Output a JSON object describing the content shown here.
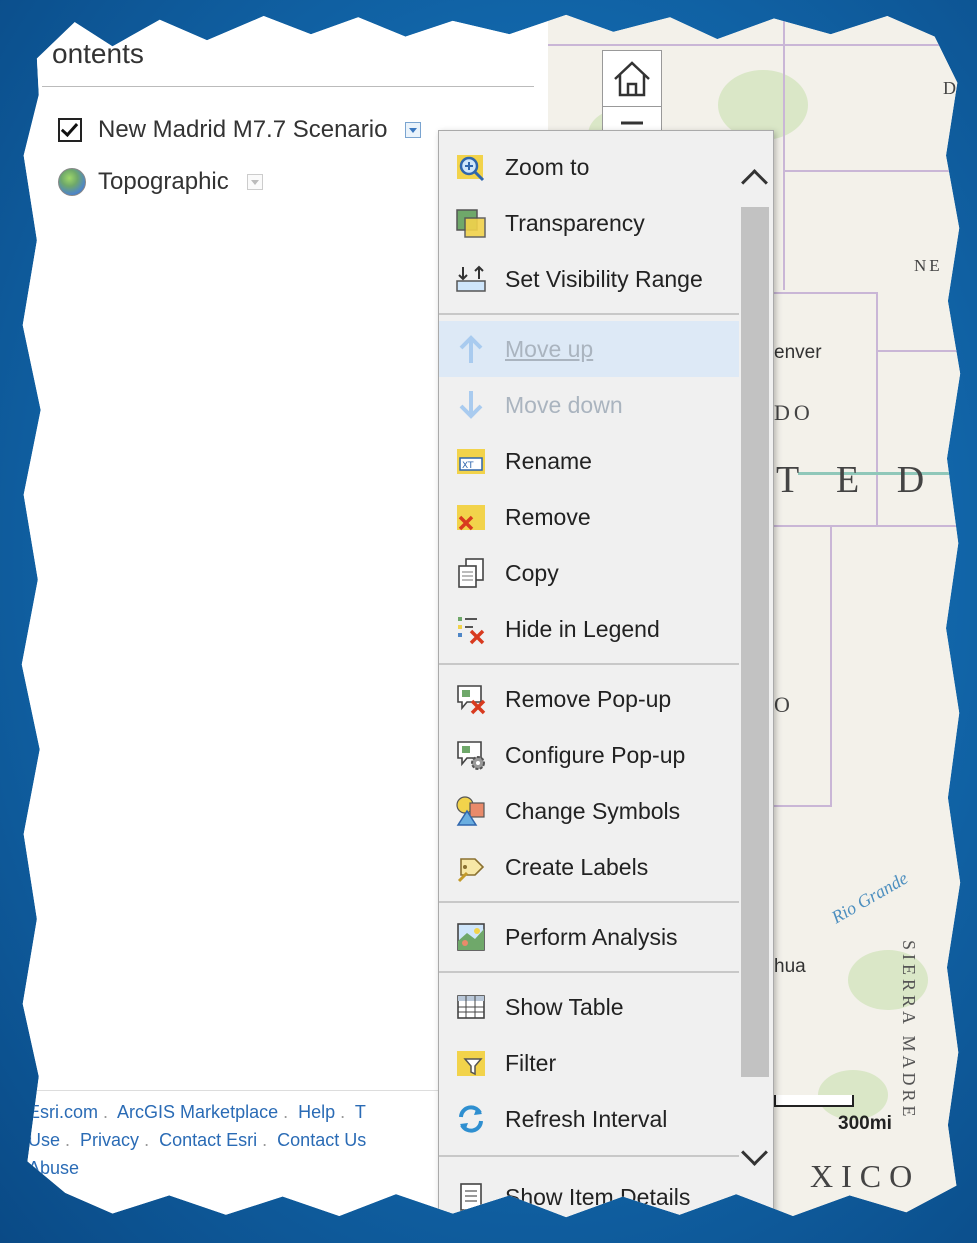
{
  "contents": {
    "title": "ontents",
    "layers": [
      {
        "name": "New Madrid M7.7 Scenario",
        "checked": true
      },
      {
        "name": "Topographic"
      }
    ],
    "footer_links": [
      "Esri.com",
      "ArcGIS Marketplace",
      "Help",
      "T",
      "Use",
      "Privacy",
      "Contact Esri",
      "Contact Us",
      "Abuse"
    ]
  },
  "map": {
    "labels": [
      "D",
      "NE",
      "enver",
      "DO",
      "T E D",
      "O",
      "Rio Grande",
      "hua",
      "SIERRA MADRE",
      "XICO"
    ],
    "scalebar": "300mi"
  },
  "context_menu": {
    "items": [
      {
        "label": "Zoom to",
        "icon": "zoom-to-icon"
      },
      {
        "label": "Transparency",
        "icon": "transparency-icon"
      },
      {
        "label": "Set Visibility Range",
        "icon": "visibility-range-icon"
      },
      {
        "label": "Move up",
        "icon": "arrow-up-icon",
        "disabled": true
      },
      {
        "label": "Move down",
        "icon": "arrow-down-icon",
        "disabled": true
      },
      {
        "label": "Rename",
        "icon": "rename-icon"
      },
      {
        "label": "Remove",
        "icon": "remove-icon"
      },
      {
        "label": "Copy",
        "icon": "copy-icon"
      },
      {
        "label": "Hide in Legend",
        "icon": "hide-legend-icon"
      },
      {
        "label": "Remove Pop-up",
        "icon": "remove-popup-icon"
      },
      {
        "label": "Configure Pop-up",
        "icon": "configure-popup-icon"
      },
      {
        "label": "Change Symbols",
        "icon": "change-symbols-icon"
      },
      {
        "label": "Create Labels",
        "icon": "create-labels-icon"
      },
      {
        "label": "Perform Analysis",
        "icon": "perform-analysis-icon"
      },
      {
        "label": "Show Table",
        "icon": "table-icon"
      },
      {
        "label": "Filter",
        "icon": "filter-icon"
      },
      {
        "label": "Refresh Interval",
        "icon": "refresh-icon"
      },
      {
        "label": "Show Item Details",
        "icon": "item-details-icon"
      }
    ]
  }
}
